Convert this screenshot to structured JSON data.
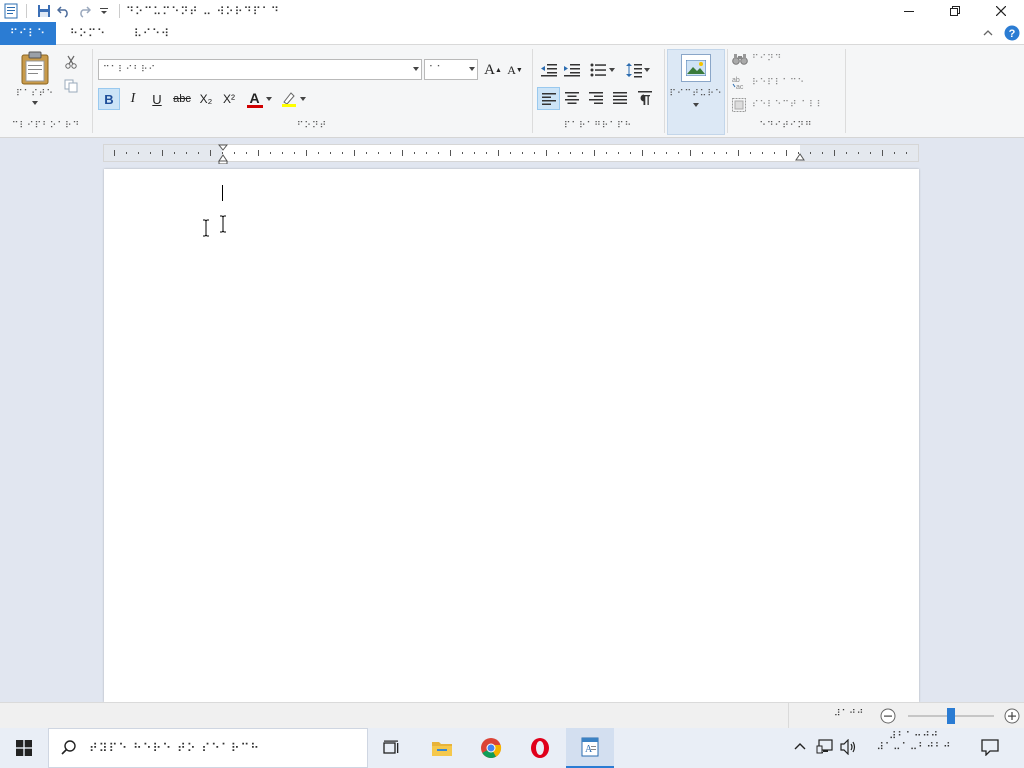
{
  "window": {
    "title": "⠙⠕⠉⠥⠍⠑⠝⠞ ⠤ ⠺⠕⠗⠙⠏⠁⠙",
    "minimize_icon": "minimize-icon",
    "maximize_icon": "maximize-icon",
    "close_icon": "close-icon"
  },
  "ribbon_tabs": [
    {
      "label": "⠋⠊⠇⠑",
      "active": true
    },
    {
      "label": "⠓⠕⠍⠑",
      "active": false
    },
    {
      "label": "⠧⠊⠑⠺",
      "active": false
    }
  ],
  "clipboard": {
    "paste_label": "⠏⠁⠎⠞⠑",
    "group_label": "⠉⠇⠊⠏⠃⠕⠁⠗⠙"
  },
  "font": {
    "family_value": "⠉⠁⠇⠊⠃⠗⠊",
    "size_value": "⠁⠁",
    "group_label": "⠋⠕⠝⠞",
    "bold": "B",
    "italic": "I",
    "underline": "U",
    "strike": "abc",
    "sub": "X₂",
    "sup": "X²",
    "grow": "A",
    "shrink": "A",
    "color_a": "A"
  },
  "paragraph": {
    "group_label": "⠏⠁⠗⠁⠛⠗⠁⠏⠓"
  },
  "insert": {
    "picture_label": "⠏⠊⠉⠞⠥⠗⠑"
  },
  "editing": {
    "find_label": "⠋⠊⠝⠙",
    "replace_label": "⠗⠑⠏⠇⠁⠉⠑",
    "select_all_label": "⠎⠑⠇⠑⠉⠞ ⠁⠇⠇",
    "group_label": "⠑⠙⠊⠞⠊⠝⠛"
  },
  "statusbar": {
    "zoom_value": "⠼⠁⠚⠚",
    "zoom_level": 0.5
  },
  "taskbar": {
    "search_placeholder": "⠞⠽⠏⠑ ⠓⠑⠗⠑ ⠞⠕ ⠎⠑⠁⠗⠉⠓",
    "clock_time": "⠼⠃⠁⠒⠚⠚",
    "clock_date": "⠼⠁⠤⠁⠤⠃⠚⠃⠚"
  },
  "colors": {
    "accent": "#2b7cd3",
    "font_color": "#d00000",
    "highlight": "#ffff00"
  }
}
